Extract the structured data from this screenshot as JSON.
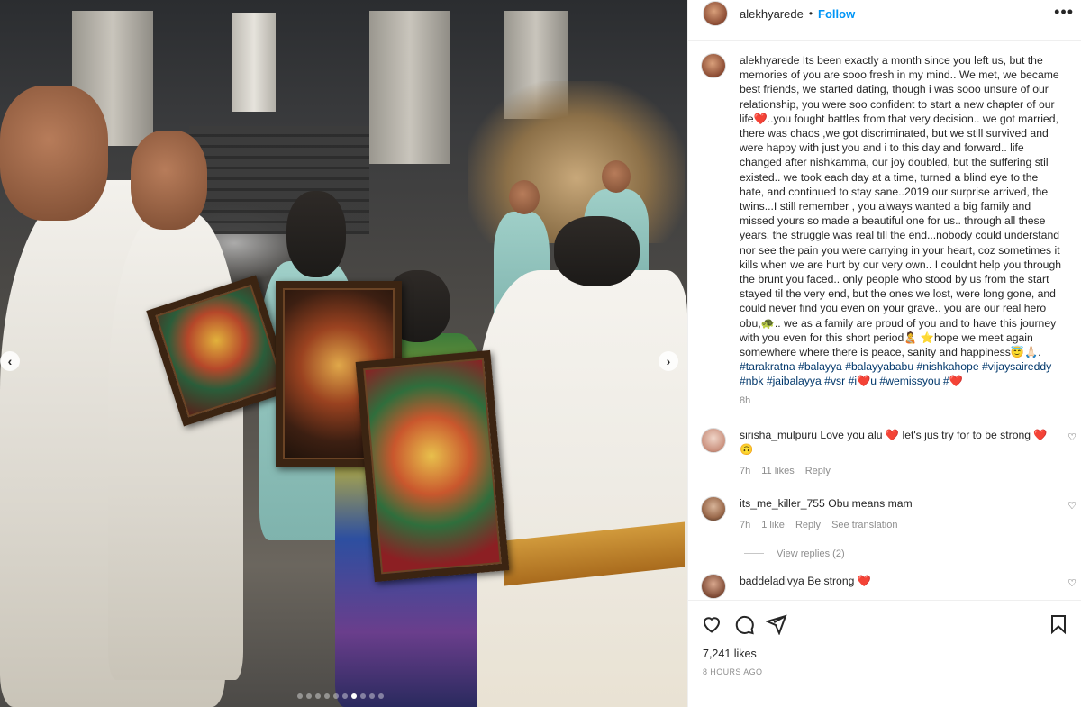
{
  "post": {
    "username": "alekhyarede",
    "separator": "•",
    "follow_label": "Follow",
    "more_label": "•••"
  },
  "caption": {
    "username": "alekhyarede",
    "text": "Its been exactly a month since you left us, but the memories of you are sooo fresh in my mind.. We met, we became best friends, we started dating, though i was sooo unsure of our relationship, you were soo confident to start a new chapter of our life❤️..you fought battles from that very decision.. we got married, there was chaos ,we got discriminated, but we still survived and were happy with just you and i to this day and forward.. life changed after nishkamma, our joy doubled, but the suffering stil existed.. we took each day at a time, turned a blind eye to the hate, and continued to stay sane..2019 our surprise arrived, the twins...I still remember , you always wanted a big family and missed yours so made a beautiful one for us.. through all these years, the struggle was real till the end...nobody could understand nor see the pain you were carrying in your heart, coz sometimes it kills when we are hurt by our very own.. I couldnt help you through the brunt you faced.. only people who stood by us from the start stayed til the very end, but the ones we lost, were long gone, and could never find you even on your grave.. you are our real hero obu,🐢.. we as a family are proud of you and to have this journey with you even for this short period🧑‍🍼 ⭐hope we meet again somewhere where there is peace, sanity and happiness😇🙏🏻. ",
    "hashtags": "#tarakratna #balayya #balayyababu #nishkahope #vijaysaireddy #nbk #jaibalayya #vsr #i❤️u #wemissyou #❤️",
    "time": "8h"
  },
  "comments": [
    {
      "username": "sirisha_mulpuru",
      "text": "Love you alu ❤️ let's jus try for to be strong ❤️🙃",
      "time": "7h",
      "likes": "11 likes",
      "reply": "Reply"
    },
    {
      "username": "its_me_killer_755",
      "text": "Obu means mam",
      "time": "7h",
      "likes": "1 like",
      "reply": "Reply",
      "translate": "See translation",
      "view_replies": "View replies (2)"
    },
    {
      "username": "baddeladivya",
      "text": "Be strong ❤️"
    }
  ],
  "actions": {
    "likes": "7,241 likes",
    "ago": "8 HOURS AGO"
  },
  "media": {
    "prev_label": "‹",
    "next_label": "›"
  },
  "colors": {
    "accent": "#0095f6",
    "hashtag": "#00376b",
    "heart": "#ed4956",
    "muted": "#8e8e8e"
  }
}
